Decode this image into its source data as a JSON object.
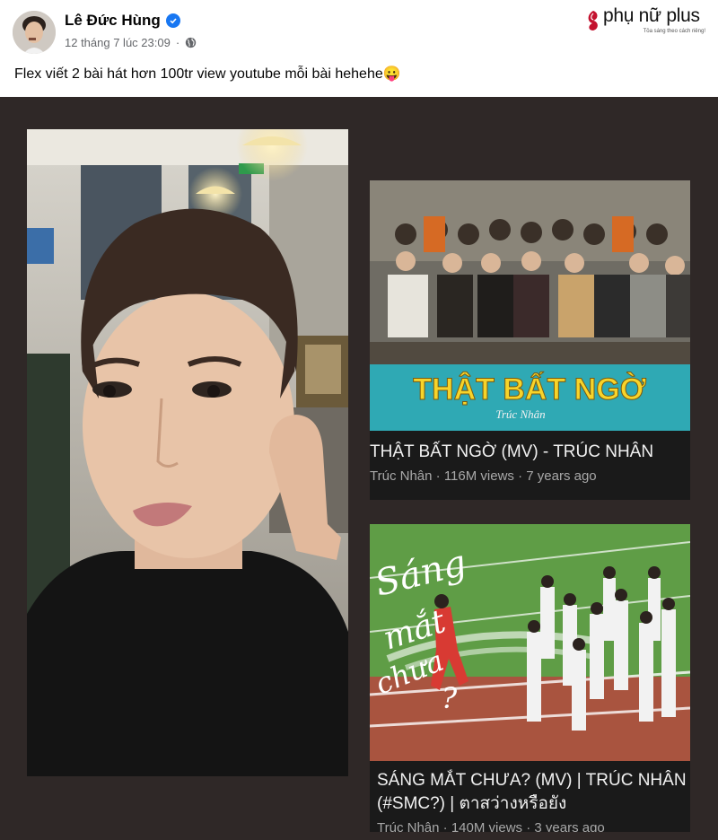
{
  "post": {
    "author": "Lê Đức Hùng",
    "timestamp": "12 tháng 7 lúc 23:09",
    "separator": "·",
    "text": "Flex viết 2 bài hát hơn 100tr view youtube mỗi bài hehehe😛"
  },
  "watermark": {
    "name": "phụ nữ plus",
    "tagline": "Tỏa sáng theo cách riêng!"
  },
  "videos": [
    {
      "title": "THẬT BẤT NGỜ (MV) - TRÚC NHÂN",
      "channel": "Trúc Nhân",
      "views": "116M views",
      "age": "7 years ago",
      "sep": "·",
      "thumb_title": "THẬT BẤT NGỜ",
      "thumb_sub": "Trúc Nhân"
    },
    {
      "title_line1": "SÁNG MẮT CHƯA? (MV) | TRÚC NHÂN",
      "title_line2": "(#SMC?) | ตาสว่างหรือยัง",
      "channel": "Trúc Nhân",
      "views": "140M views",
      "age": "3 years ago",
      "sep": "·",
      "thumb_title_1": "Sáng",
      "thumb_title_2": "mắt",
      "thumb_title_3": "chưa",
      "thumb_title_4": "?"
    }
  ],
  "colors": {
    "verified": "#1877f2",
    "media_bg": "#2f2827",
    "card_bg": "#1a1a1a",
    "thumb_banner": "#2fa9b4",
    "thumb_title": "#f7d42a",
    "logo_accent": "#c4122f"
  },
  "icons": {
    "verified": "check-badge-icon",
    "privacy": "globe-icon",
    "logo": "leaf-icon"
  }
}
